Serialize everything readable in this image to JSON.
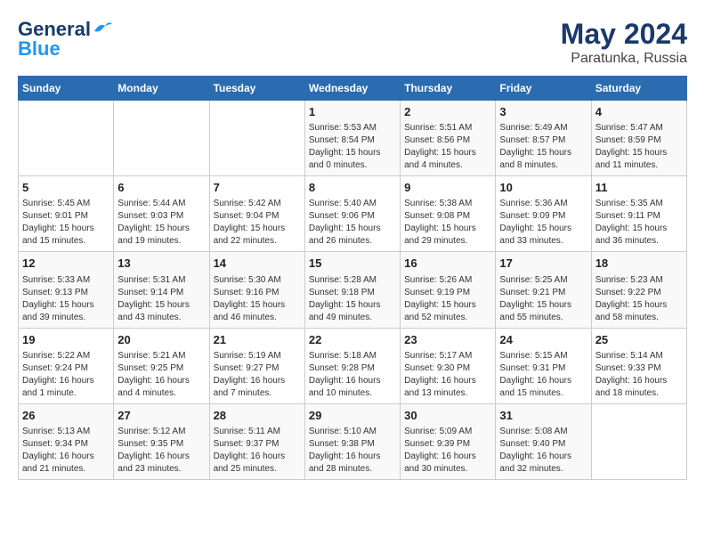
{
  "logo": {
    "line1": "General",
    "line2": "Blue"
  },
  "title": "May 2024",
  "subtitle": "Paratunka, Russia",
  "weekdays": [
    "Sunday",
    "Monday",
    "Tuesday",
    "Wednesday",
    "Thursday",
    "Friday",
    "Saturday"
  ],
  "weeks": [
    [
      {
        "day": "",
        "info": ""
      },
      {
        "day": "",
        "info": ""
      },
      {
        "day": "",
        "info": ""
      },
      {
        "day": "1",
        "info": "Sunrise: 5:53 AM\nSunset: 8:54 PM\nDaylight: 15 hours\nand 0 minutes."
      },
      {
        "day": "2",
        "info": "Sunrise: 5:51 AM\nSunset: 8:56 PM\nDaylight: 15 hours\nand 4 minutes."
      },
      {
        "day": "3",
        "info": "Sunrise: 5:49 AM\nSunset: 8:57 PM\nDaylight: 15 hours\nand 8 minutes."
      },
      {
        "day": "4",
        "info": "Sunrise: 5:47 AM\nSunset: 8:59 PM\nDaylight: 15 hours\nand 11 minutes."
      }
    ],
    [
      {
        "day": "5",
        "info": "Sunrise: 5:45 AM\nSunset: 9:01 PM\nDaylight: 15 hours\nand 15 minutes."
      },
      {
        "day": "6",
        "info": "Sunrise: 5:44 AM\nSunset: 9:03 PM\nDaylight: 15 hours\nand 19 minutes."
      },
      {
        "day": "7",
        "info": "Sunrise: 5:42 AM\nSunset: 9:04 PM\nDaylight: 15 hours\nand 22 minutes."
      },
      {
        "day": "8",
        "info": "Sunrise: 5:40 AM\nSunset: 9:06 PM\nDaylight: 15 hours\nand 26 minutes."
      },
      {
        "day": "9",
        "info": "Sunrise: 5:38 AM\nSunset: 9:08 PM\nDaylight: 15 hours\nand 29 minutes."
      },
      {
        "day": "10",
        "info": "Sunrise: 5:36 AM\nSunset: 9:09 PM\nDaylight: 15 hours\nand 33 minutes."
      },
      {
        "day": "11",
        "info": "Sunrise: 5:35 AM\nSunset: 9:11 PM\nDaylight: 15 hours\nand 36 minutes."
      }
    ],
    [
      {
        "day": "12",
        "info": "Sunrise: 5:33 AM\nSunset: 9:13 PM\nDaylight: 15 hours\nand 39 minutes."
      },
      {
        "day": "13",
        "info": "Sunrise: 5:31 AM\nSunset: 9:14 PM\nDaylight: 15 hours\nand 43 minutes."
      },
      {
        "day": "14",
        "info": "Sunrise: 5:30 AM\nSunset: 9:16 PM\nDaylight: 15 hours\nand 46 minutes."
      },
      {
        "day": "15",
        "info": "Sunrise: 5:28 AM\nSunset: 9:18 PM\nDaylight: 15 hours\nand 49 minutes."
      },
      {
        "day": "16",
        "info": "Sunrise: 5:26 AM\nSunset: 9:19 PM\nDaylight: 15 hours\nand 52 minutes."
      },
      {
        "day": "17",
        "info": "Sunrise: 5:25 AM\nSunset: 9:21 PM\nDaylight: 15 hours\nand 55 minutes."
      },
      {
        "day": "18",
        "info": "Sunrise: 5:23 AM\nSunset: 9:22 PM\nDaylight: 15 hours\nand 58 minutes."
      }
    ],
    [
      {
        "day": "19",
        "info": "Sunrise: 5:22 AM\nSunset: 9:24 PM\nDaylight: 16 hours\nand 1 minute."
      },
      {
        "day": "20",
        "info": "Sunrise: 5:21 AM\nSunset: 9:25 PM\nDaylight: 16 hours\nand 4 minutes."
      },
      {
        "day": "21",
        "info": "Sunrise: 5:19 AM\nSunset: 9:27 PM\nDaylight: 16 hours\nand 7 minutes."
      },
      {
        "day": "22",
        "info": "Sunrise: 5:18 AM\nSunset: 9:28 PM\nDaylight: 16 hours\nand 10 minutes."
      },
      {
        "day": "23",
        "info": "Sunrise: 5:17 AM\nSunset: 9:30 PM\nDaylight: 16 hours\nand 13 minutes."
      },
      {
        "day": "24",
        "info": "Sunrise: 5:15 AM\nSunset: 9:31 PM\nDaylight: 16 hours\nand 15 minutes."
      },
      {
        "day": "25",
        "info": "Sunrise: 5:14 AM\nSunset: 9:33 PM\nDaylight: 16 hours\nand 18 minutes."
      }
    ],
    [
      {
        "day": "26",
        "info": "Sunrise: 5:13 AM\nSunset: 9:34 PM\nDaylight: 16 hours\nand 21 minutes."
      },
      {
        "day": "27",
        "info": "Sunrise: 5:12 AM\nSunset: 9:35 PM\nDaylight: 16 hours\nand 23 minutes."
      },
      {
        "day": "28",
        "info": "Sunrise: 5:11 AM\nSunset: 9:37 PM\nDaylight: 16 hours\nand 25 minutes."
      },
      {
        "day": "29",
        "info": "Sunrise: 5:10 AM\nSunset: 9:38 PM\nDaylight: 16 hours\nand 28 minutes."
      },
      {
        "day": "30",
        "info": "Sunrise: 5:09 AM\nSunset: 9:39 PM\nDaylight: 16 hours\nand 30 minutes."
      },
      {
        "day": "31",
        "info": "Sunrise: 5:08 AM\nSunset: 9:40 PM\nDaylight: 16 hours\nand 32 minutes."
      },
      {
        "day": "",
        "info": ""
      }
    ]
  ]
}
